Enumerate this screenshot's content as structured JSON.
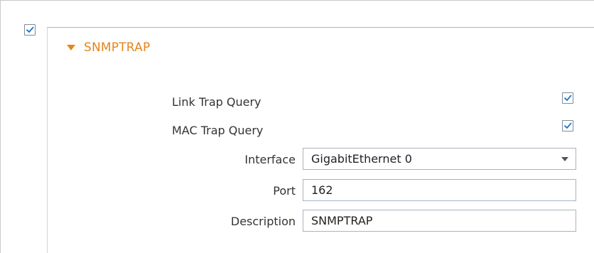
{
  "section": {
    "enabled": true,
    "title": "SNMPTRAP",
    "expanded": true
  },
  "fields": {
    "link_trap_query": {
      "label": "Link Trap Query",
      "checked": true
    },
    "mac_trap_query": {
      "label": "MAC Trap Query",
      "checked": true
    },
    "interface": {
      "label": "Interface",
      "value": "GigabitEthernet 0"
    },
    "port": {
      "label": "Port",
      "value": "162"
    },
    "description": {
      "label": "Description",
      "value": "SNMPTRAP"
    }
  },
  "colors": {
    "accent": "#e3861b",
    "check": "#1a73c8",
    "panel_border": "#9fb8cf"
  },
  "icons": {
    "checkbox": "checkmark-icon",
    "collapse": "caret-down-icon",
    "dropdown": "chevron-down-icon"
  }
}
